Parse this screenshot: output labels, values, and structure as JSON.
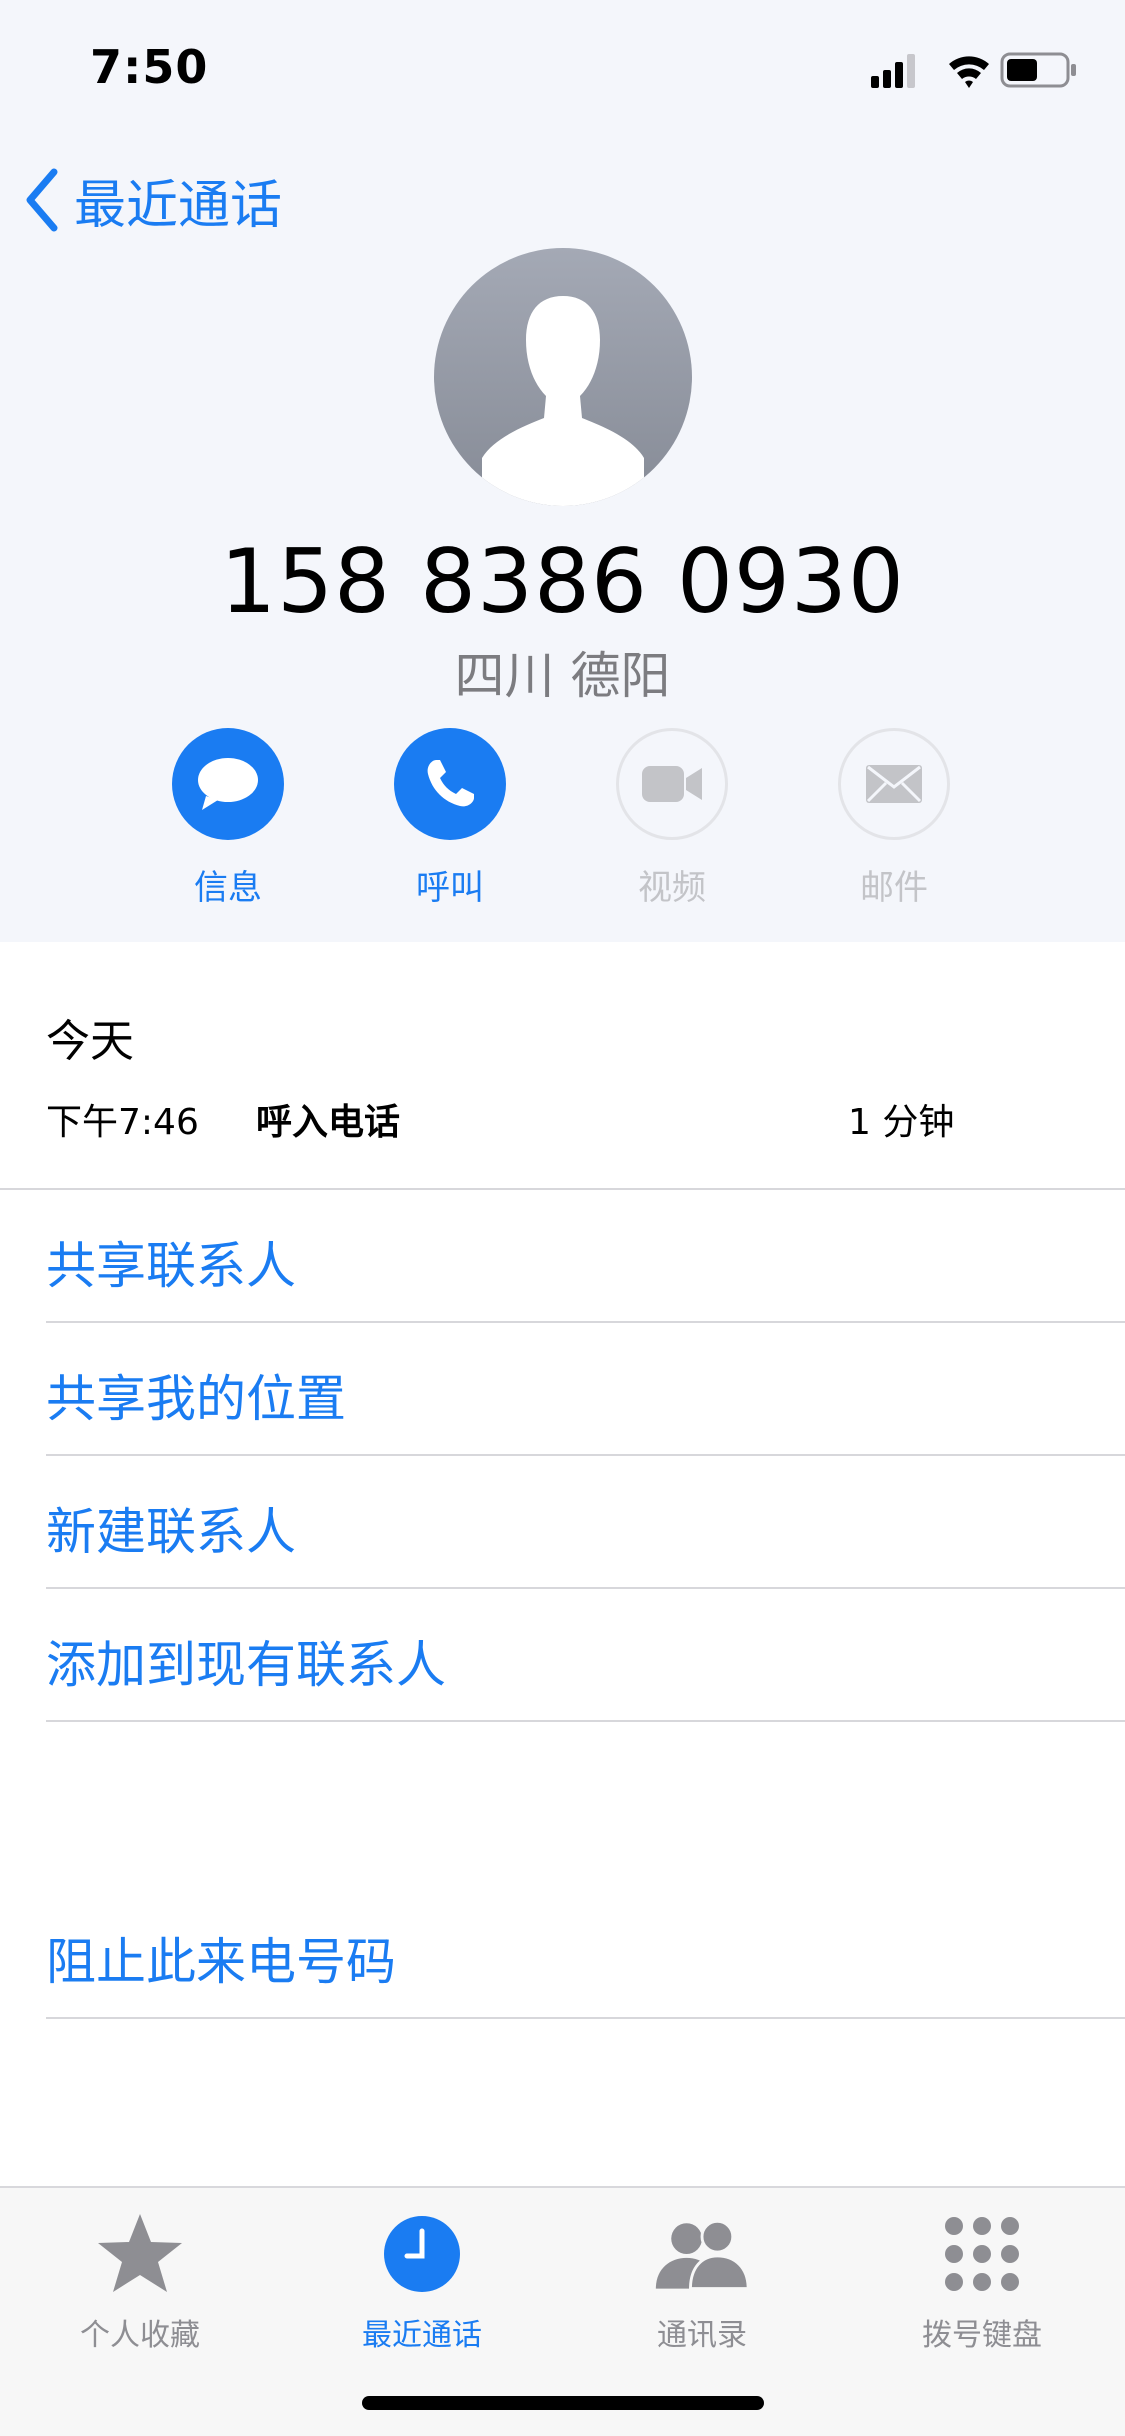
{
  "status_bar": {
    "time": "7:50"
  },
  "nav": {
    "back_label": "最近通话"
  },
  "contact": {
    "phone_number": "158 8386 0930",
    "location": "四川 德阳"
  },
  "actions": [
    {
      "label": "信息",
      "icon": "message-icon",
      "enabled": true
    },
    {
      "label": "呼叫",
      "icon": "phone-icon",
      "enabled": true
    },
    {
      "label": "视频",
      "icon": "video-icon",
      "enabled": false
    },
    {
      "label": "邮件",
      "icon": "mail-icon",
      "enabled": false
    }
  ],
  "recent_call": {
    "day": "今天",
    "time": "下午7:46",
    "type": "呼入电话",
    "duration": "1 分钟"
  },
  "menu": {
    "share_contact": "共享联系人",
    "share_location": "共享我的位置",
    "new_contact": "新建联系人",
    "add_to_existing": "添加到现有联系人",
    "block_caller": "阻止此来电号码"
  },
  "tabbar": [
    {
      "label": "个人收藏",
      "icon": "star-icon",
      "active": false
    },
    {
      "label": "最近通话",
      "icon": "clock-icon",
      "active": true
    },
    {
      "label": "通讯录",
      "icon": "contacts-icon",
      "active": false
    },
    {
      "label": "拨号键盘",
      "icon": "keypad-icon",
      "active": false
    }
  ],
  "colors": {
    "accent": "#1a7cf2",
    "header_bg": "#f4f6fb",
    "disabled": "#c3c4c8"
  }
}
